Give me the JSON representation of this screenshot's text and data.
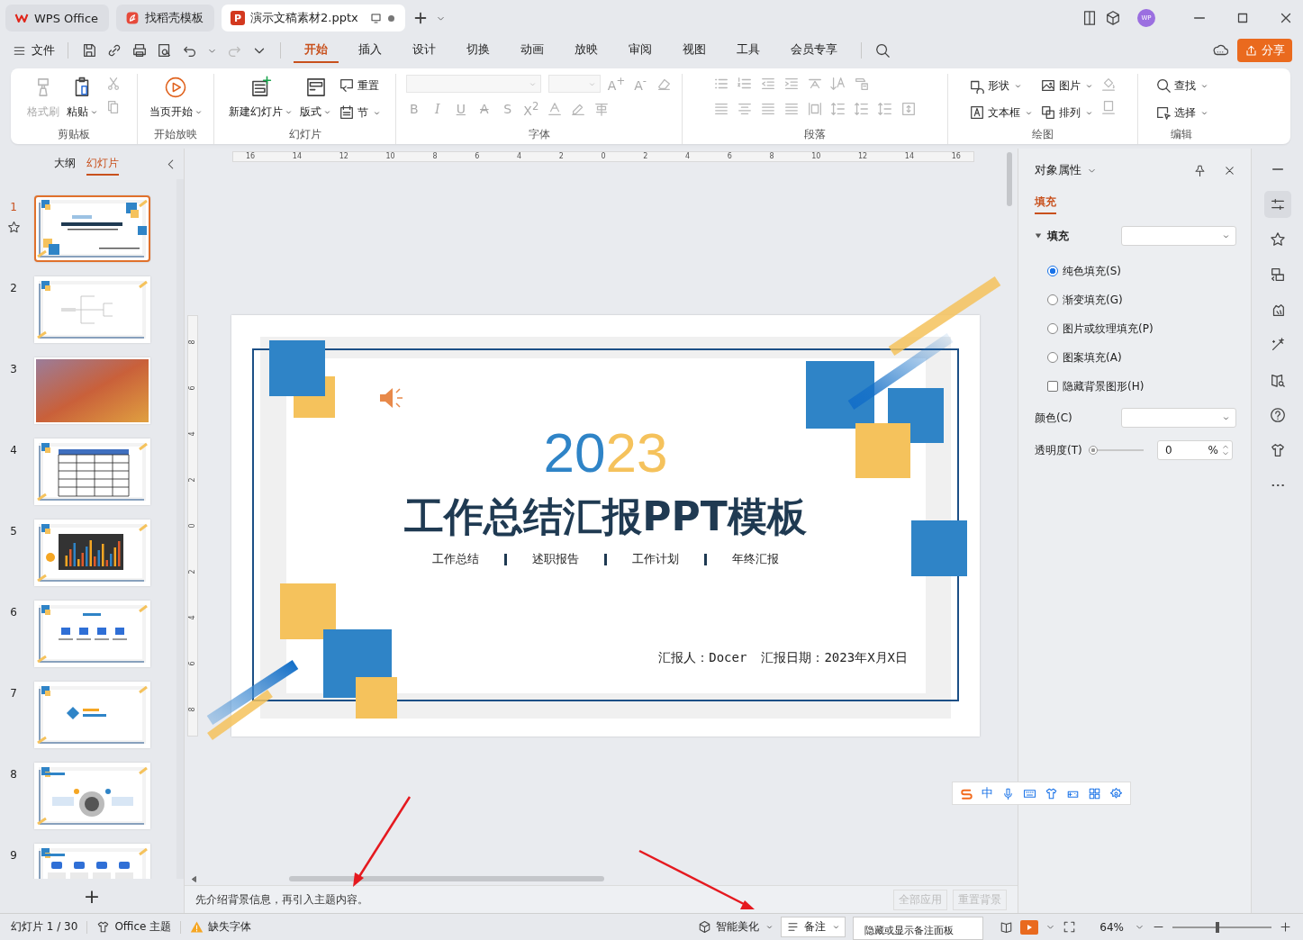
{
  "title_bar": {
    "tabs": [
      {
        "label": "WPS Office",
        "selected": false,
        "kind": "home"
      },
      {
        "label": "找稻壳模板",
        "selected": false,
        "kind": "docer"
      },
      {
        "label": "演示文稿素材2.pptx",
        "selected": true,
        "kind": "document",
        "badge": "P"
      }
    ],
    "avatar": "WP"
  },
  "menu": {
    "file": "文件",
    "tabs": [
      {
        "label": "开始",
        "selected": true
      },
      {
        "label": "插入",
        "selected": false
      },
      {
        "label": "设计",
        "selected": false
      },
      {
        "label": "切换",
        "selected": false
      },
      {
        "label": "动画",
        "selected": false
      },
      {
        "label": "放映",
        "selected": false
      },
      {
        "label": "审阅",
        "selected": false
      },
      {
        "label": "视图",
        "selected": false
      },
      {
        "label": "工具",
        "selected": false
      },
      {
        "label": "会员专享",
        "selected": false
      }
    ],
    "share": "分享"
  },
  "ribbon": {
    "clipboard": {
      "label": "剪贴板",
      "format_painter": {
        "label": "格式刷",
        "disabled": true
      },
      "paste": {
        "label": "粘贴",
        "disabled": false
      },
      "cut_disabled": true,
      "copy_disabled": true
    },
    "slideshow": {
      "label": "开始放映",
      "from_current": "当页开始"
    },
    "slides": {
      "label": "幻灯片",
      "new_slide": "新建幻灯片",
      "layout": "版式",
      "reset": "重置",
      "section": "节"
    },
    "font": {
      "label": "字体",
      "disabled": true,
      "size_buttons": [
        "A$^{+}$",
        "A$^{-}$"
      ],
      "style_buttons": [
        "B",
        "I",
        "U",
        "A",
        "S",
        "X$^{2}$"
      ]
    },
    "paragraph": {
      "label": "段落",
      "disabled": true
    },
    "drawing": {
      "label": "绘图",
      "shape": "形状",
      "picture": "图片",
      "textbox": "文本框",
      "arrange": "排列"
    },
    "editing": {
      "label": "编辑",
      "find": "查找",
      "select": "选择"
    }
  },
  "slide_panel": {
    "tabs": [
      {
        "label": "大纲",
        "selected": false
      },
      {
        "label": "幻灯片",
        "selected": true
      }
    ],
    "slides": [
      {
        "number": "1",
        "selected": true,
        "kind": "title"
      },
      {
        "number": "2",
        "selected": false,
        "kind": "mindmap"
      },
      {
        "number": "3",
        "selected": false,
        "kind": "photo"
      },
      {
        "number": "4",
        "selected": false,
        "kind": "table"
      },
      {
        "number": "5",
        "selected": false,
        "kind": "chart"
      },
      {
        "number": "6",
        "selected": false,
        "kind": "agenda"
      },
      {
        "number": "7",
        "selected": false,
        "kind": "section"
      },
      {
        "number": "8",
        "selected": false,
        "kind": "diagram"
      },
      {
        "number": "9",
        "selected": false,
        "kind": "cards"
      }
    ],
    "add": "+"
  },
  "ruler": {
    "horizontal": [
      "16",
      "14",
      "12",
      "10",
      "8",
      "6",
      "4",
      "2",
      "0",
      "2",
      "4",
      "6",
      "8",
      "10",
      "12",
      "14",
      "16"
    ],
    "vertical": [
      "8",
      "6",
      "4",
      "2",
      "0",
      "2",
      "4",
      "6",
      "8"
    ]
  },
  "slide": {
    "year": [
      "20",
      "23"
    ],
    "title": "工作总结汇报PPT模板",
    "subtitles": [
      "工作总结",
      "述职报告",
      "工作计划",
      "年终汇报"
    ],
    "reporter": "汇报人：Docer",
    "date": "汇报日期：2023年X月X日"
  },
  "notes": {
    "text": "先介绍背景信息，再引入主题内容。",
    "buttons": [
      "全部应用",
      "重置背景"
    ]
  },
  "ime_toolbar": {
    "mode": "中"
  },
  "properties": {
    "title": "对象属性",
    "tabs": [
      {
        "label": "填充",
        "selected": true
      }
    ],
    "section": {
      "label": "填充",
      "expanded": true
    },
    "fill_options": [
      {
        "label": "纯色填充(S)",
        "selected": true
      },
      {
        "label": "渐变填充(G)",
        "selected": false
      },
      {
        "label": "图片或纹理填充(P)",
        "selected": false
      },
      {
        "label": "图案填充(A)",
        "selected": false
      }
    ],
    "hide_background": {
      "label": "隐藏背景图形(H)",
      "checked": false
    },
    "color_label": "颜色(C)",
    "transparency": {
      "label": "透明度(T)",
      "level": 0,
      "value": "0",
      "unit": "%"
    }
  },
  "status_bar": {
    "slide_counter": "幻灯片 1 / 30",
    "theme": "Office 主题",
    "missing_fonts": "缺失字体",
    "beautify": "智能美化",
    "notes_button": {
      "label": "备注",
      "selected": true
    },
    "tooltip": "隐藏或显示备注面板",
    "zoom": "64%",
    "zoom_level": {
      "level": 0.45
    }
  }
}
